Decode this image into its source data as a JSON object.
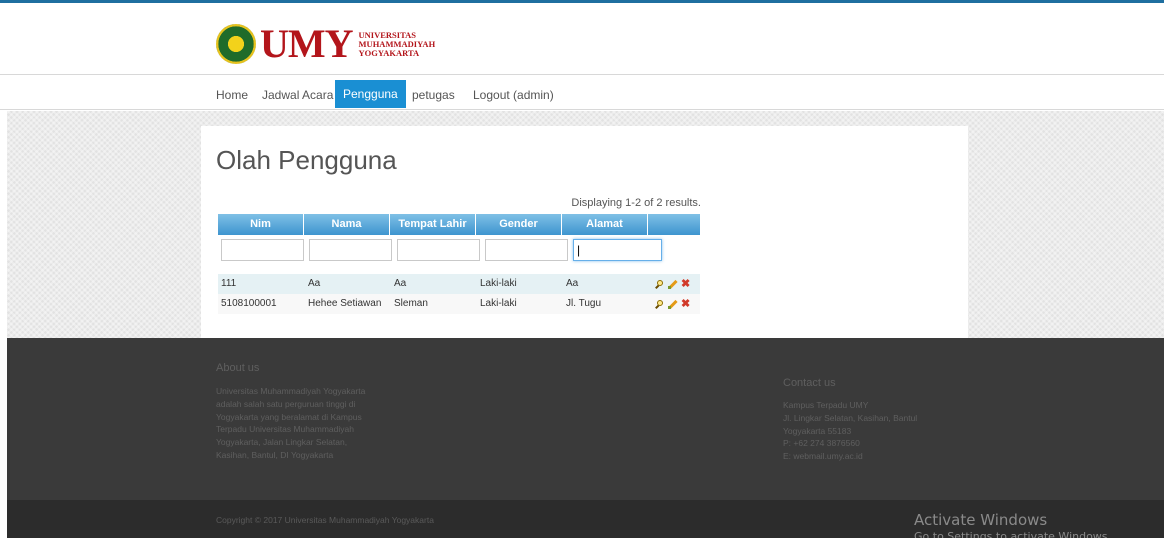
{
  "brand": {
    "logo_text": "UMY",
    "logo_sub": [
      "UNIVERSITAS",
      "MUHAMMADIYAH",
      "YOGYAKARTA"
    ]
  },
  "nav": {
    "items": [
      {
        "label": "Home"
      },
      {
        "label": "Jadwal Acara"
      },
      {
        "label": "Pengguna",
        "active": true
      },
      {
        "label": "petugas"
      },
      {
        "label": "Logout (admin)"
      }
    ]
  },
  "page": {
    "title": "Olah Pengguna",
    "summary": "Displaying 1-2 of 2 results."
  },
  "grid": {
    "columns": [
      "Nim",
      "Nama",
      "Tempat Lahir",
      "Gender",
      "Alamat"
    ],
    "filters": [
      "",
      "",
      "",
      "",
      "|"
    ],
    "rows": [
      {
        "nim": "111",
        "nama": "Aa",
        "tempat_lahir": "Aa",
        "gender": "Laki-laki",
        "alamat": "Aa"
      },
      {
        "nim": "5108100001",
        "nama": "Hehee Setiawan",
        "tempat_lahir": "Sleman",
        "gender": "Laki-laki",
        "alamat": "Jl. Tugu"
      }
    ],
    "row_actions": [
      "view-icon",
      "edit-icon",
      "delete-icon"
    ]
  },
  "footer": {
    "about": {
      "heading": "About us",
      "lines": [
        "Universitas Muhammadiyah Yogyakarta",
        "adalah salah satu perguruan tinggi di",
        "Yogyakarta yang beralamat di Kampus",
        "Terpadu Universitas Muhammadiyah",
        "Yogyakarta, Jalan Lingkar Selatan,",
        "Kasihan, Bantul, DI Yogyakarta"
      ]
    },
    "contact": {
      "heading": "Contact us",
      "lines": [
        "Kampus Terpadu UMY",
        "Jl. Lingkar Selatan, Kasihan, Bantul",
        "Yogyakarta 55183",
        "P: +62 274 3876560",
        "E: webmail.umy.ac.id"
      ]
    },
    "copyright": "Copyright © 2017 Universitas Muhammadiyah Yogyakarta"
  },
  "os_overlay": {
    "title": "Activate Windows",
    "subtitle": "Go to Settings to activate Windows."
  },
  "colors": {
    "accent": "#1a8fd3",
    "brand_red": "#b3151b",
    "footer_bg": "#3a3a3a"
  }
}
